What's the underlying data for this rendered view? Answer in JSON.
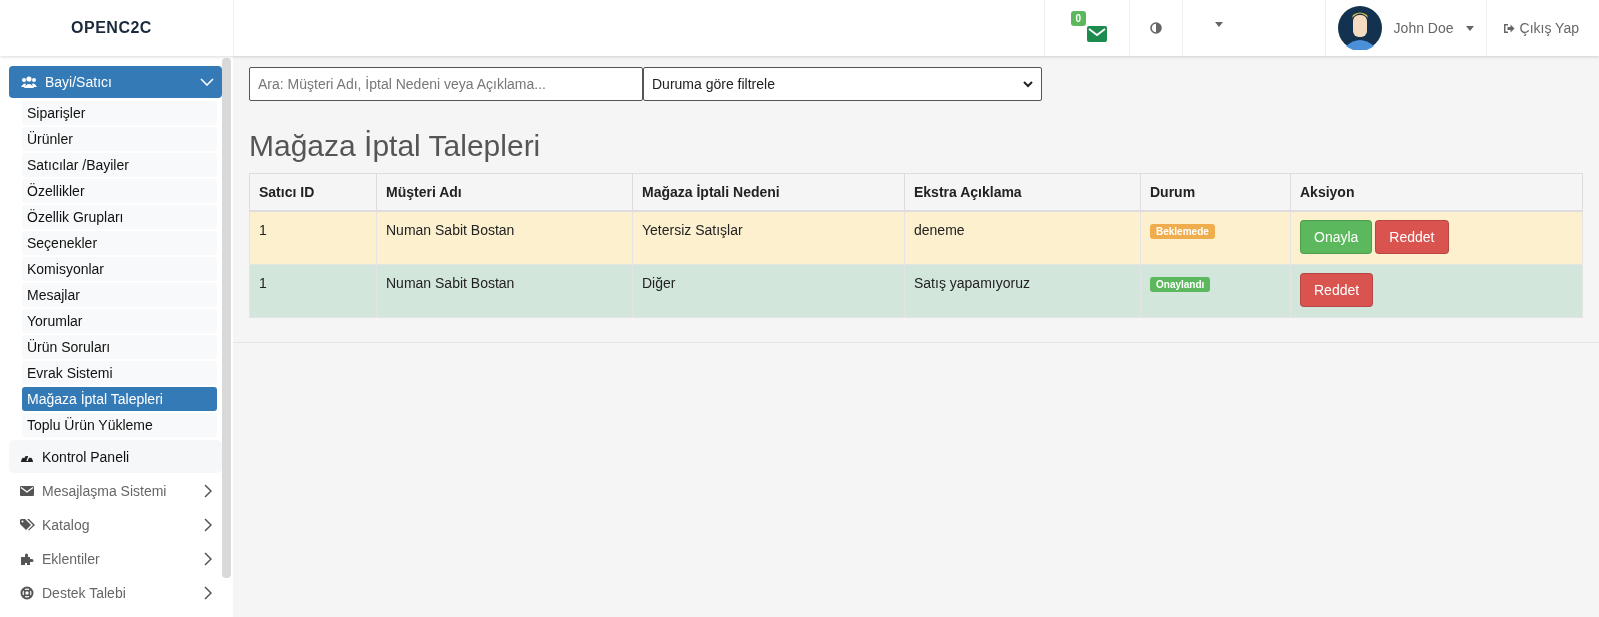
{
  "brand": "OPENC2C",
  "topbar": {
    "mail_count": "0",
    "user_name": "John Doe",
    "logout": "Çıkış Yap"
  },
  "sidebar": {
    "group": {
      "label": "Bayi/Satıcı",
      "expanded": true,
      "children": [
        {
          "label": "Siparişler",
          "selected": false
        },
        {
          "label": "Ürünler",
          "selected": false
        },
        {
          "label": "Satıcılar /Bayiler",
          "selected": false
        },
        {
          "label": "Özellikler",
          "selected": false
        },
        {
          "label": "Özellik Grupları",
          "selected": false
        },
        {
          "label": "Seçenekler",
          "selected": false
        },
        {
          "label": "Komisyonlar",
          "selected": false
        },
        {
          "label": "Mesajlar",
          "selected": false
        },
        {
          "label": "Yorumlar",
          "selected": false
        },
        {
          "label": "Ürün Soruları",
          "selected": false
        },
        {
          "label": "Evrak Sistemi",
          "selected": false
        },
        {
          "label": "Mağaza İptal Talepleri",
          "selected": true
        },
        {
          "label": "Toplu Ürün Yükleme",
          "selected": false
        }
      ]
    },
    "items": [
      {
        "label": "Kontrol Paneli",
        "kind": "link"
      },
      {
        "label": "Mesajlaşma Sistemi",
        "kind": "menu"
      },
      {
        "label": "Katalog",
        "kind": "menu"
      },
      {
        "label": "Eklentiler",
        "kind": "menu"
      },
      {
        "label": "Destek Talebi",
        "kind": "menu"
      }
    ]
  },
  "filters": {
    "search": {
      "placeholder": "Ara: Müşteri Adı, İptal Nedeni veya Açıklama..."
    },
    "status_select": {
      "value": "Duruma göre filtrele"
    }
  },
  "page_title": "Mağaza İptal Talepleri",
  "table": {
    "columns": [
      "Satıcı ID",
      "Müşteri Adı",
      "Mağaza İptali Nedeni",
      "Ekstra Açıklama",
      "Durum",
      "Aksiyon"
    ],
    "rows": [
      {
        "seller_id": "1",
        "customer": "Numan Sabit Bostan",
        "reason": "Yetersiz Satışlar",
        "note": "deneme",
        "status": {
          "label": "Beklemede",
          "kind": "pending"
        },
        "actions": [
          {
            "label": "Onayla",
            "kind": "approve"
          },
          {
            "label": "Reddet",
            "kind": "reject"
          }
        ]
      },
      {
        "seller_id": "1",
        "customer": "Numan Sabit Bostan",
        "reason": "Diğer",
        "note": "Satış yapamıyoruz",
        "status": {
          "label": "Onaylandı",
          "kind": "approved"
        },
        "actions": [
          {
            "label": "Reddet",
            "kind": "reject"
          }
        ]
      }
    ]
  }
}
